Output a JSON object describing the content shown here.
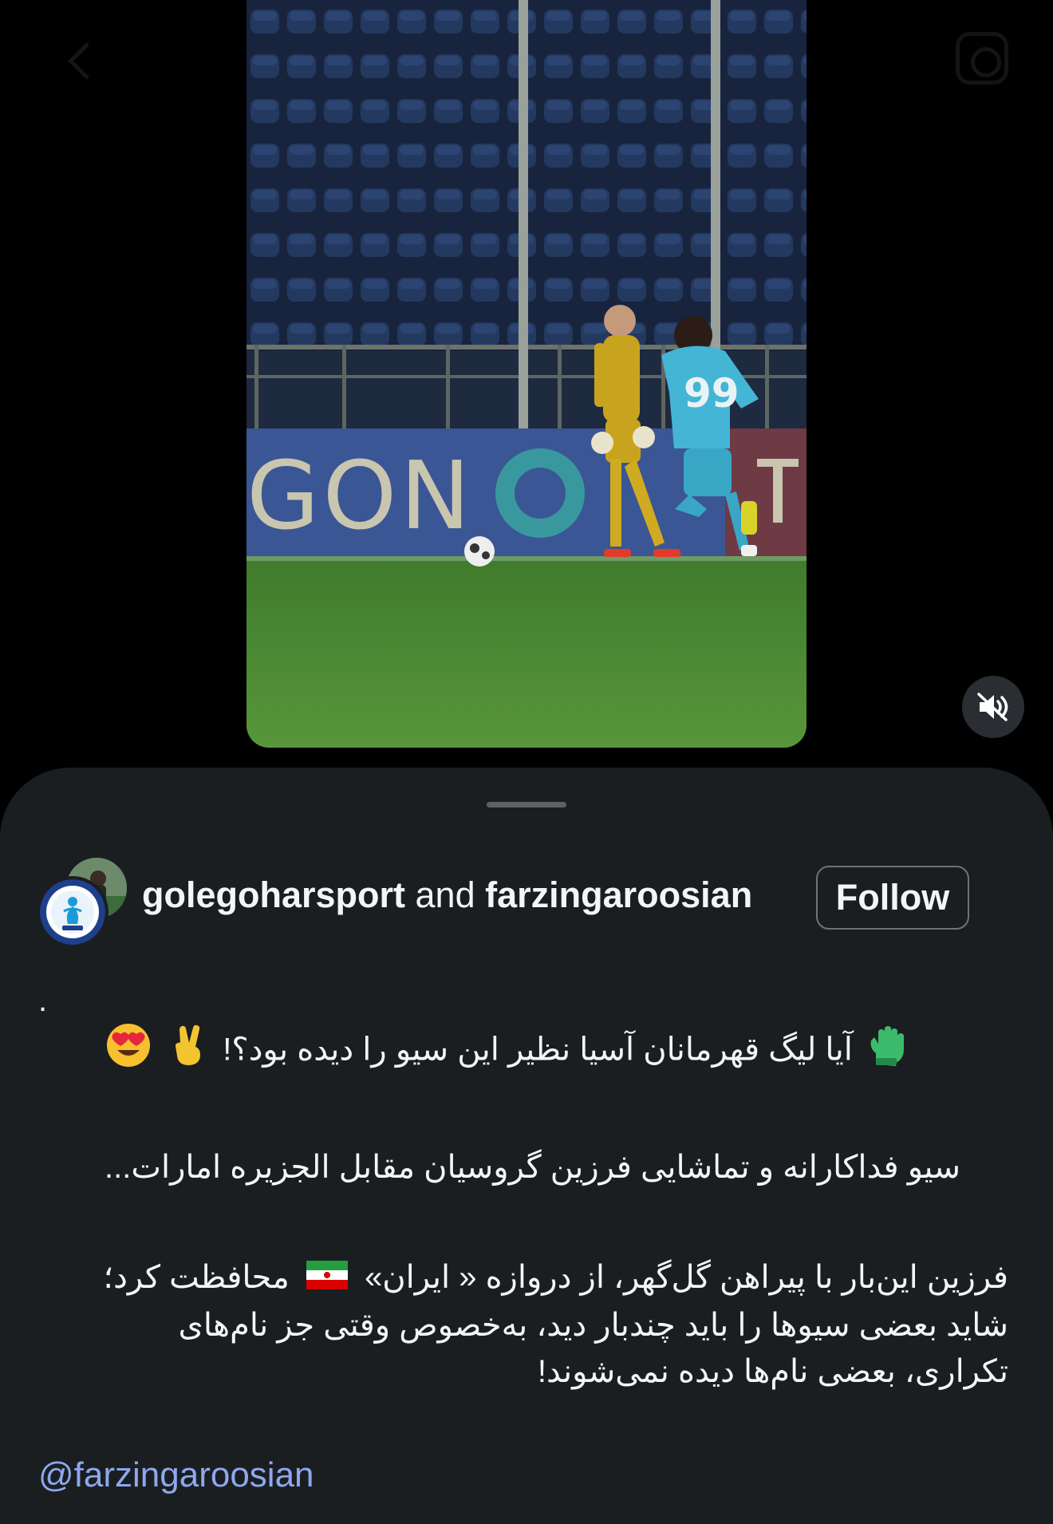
{
  "video": {
    "board_text": "GON",
    "jersey_number": "99",
    "mute_icon": "speaker-muted-icon"
  },
  "post": {
    "author_primary": "golegoharsport",
    "connector": "and",
    "author_secondary": "farzingaroosian",
    "follow_label": "Follow"
  },
  "caption": {
    "dot": ".",
    "line1_text": "آیا لیگ قهرمانان آسیا نظیر این سیو را دیده بود؟!",
    "line1_leading_emoji": "glove-icon",
    "line1_trailing_emojis": [
      "victory-hand-icon",
      "heart-eyes-icon"
    ],
    "line2": "سیو فداکارانه و تماشایی فرزین گروسیان مقابل الجزیره امارات...",
    "para3_line1_before_flag": "فرزین این‌بار با پیراهن گل‌گهر، از دروازه « ایران»",
    "para3_line1_after_flag": "محافظت کرد؛",
    "para3_flag": "iran-flag-icon",
    "para3_line2": "شاید بعضی سیوها را باید چندبار دید، به‌خصوص وقتی جز نام‌های",
    "para3_line3": "تکراری، بعضی نام‌ها دیده نمی‌شوند!",
    "mention": "@farzingaroosian"
  },
  "colors": {
    "sheet_background": "#1b1e21",
    "mention_link": "#8ea7ee",
    "pitch_green": "#4c8a34"
  }
}
